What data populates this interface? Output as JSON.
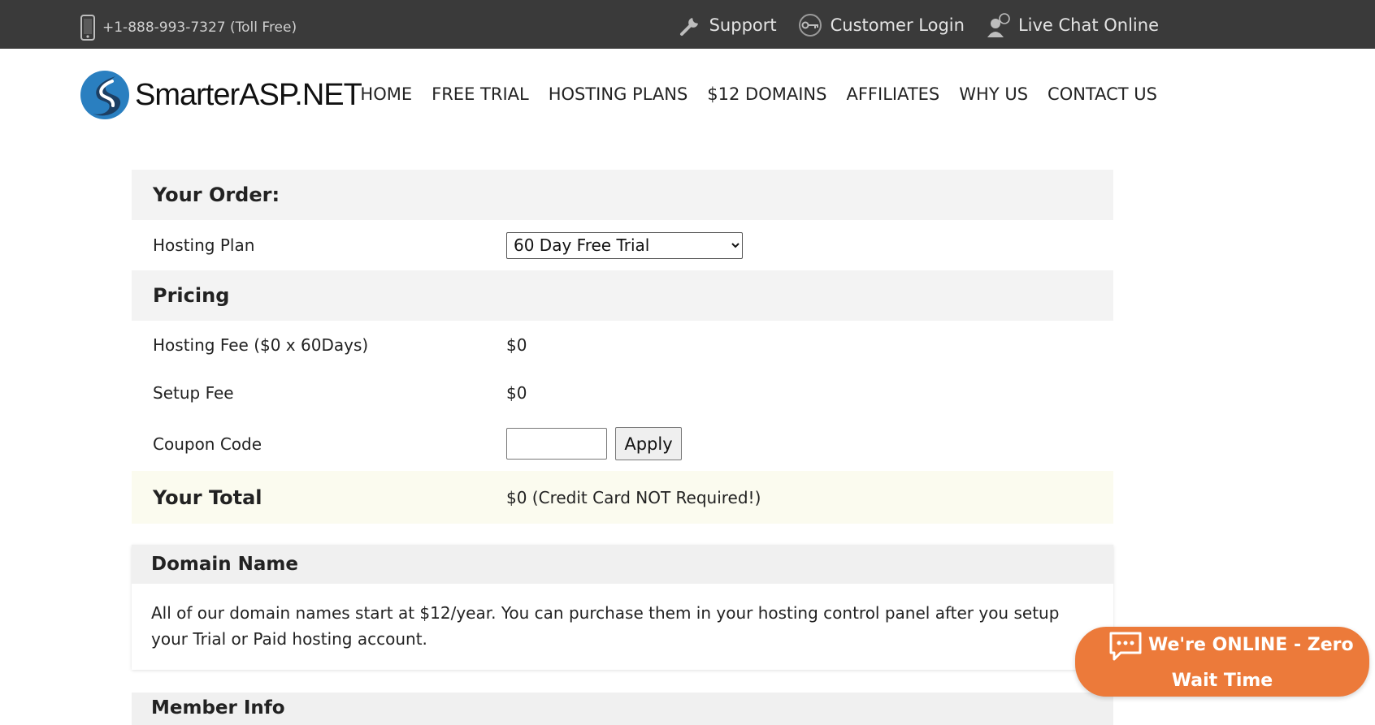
{
  "topbar": {
    "phone": "+1-888-993-7327 (Toll Free)",
    "links": [
      "Support",
      "Customer Login",
      "Live Chat Online"
    ]
  },
  "logo": {
    "text": "SmarterASP.NET"
  },
  "nav": [
    "HOME",
    "FREE TRIAL",
    "HOSTING PLANS",
    "$12 DOMAINS",
    "AFFILIATES",
    "WHY US",
    "CONTACT US"
  ],
  "order": {
    "heading": "Your Order:",
    "plan_label": "Hosting Plan",
    "plan_selected": "60 Day Free Trial",
    "pricing_heading": "Pricing",
    "hosting_fee_label": "Hosting Fee ($0 x 60Days)",
    "hosting_fee_value": "$0",
    "setup_fee_label": "Setup Fee",
    "setup_fee_value": "$0",
    "coupon_label": "Coupon Code",
    "coupon_value": "",
    "apply_label": "Apply",
    "total_label": "Your Total",
    "total_value": "$0 (Credit Card NOT Required!)"
  },
  "domain": {
    "heading": "Domain Name",
    "body": "All of our domain names start at $12/year. You can purchase them in your hosting control panel after you setup your Trial or Paid hosting account."
  },
  "member": {
    "heading": "Member Info"
  },
  "chat": {
    "line1": "We're ONLINE - Zero",
    "line2": "Wait Time"
  },
  "colors": {
    "topbar": "#3a3a3a",
    "chat": "#ec7a3a",
    "logo_blue": "#2a7fc0",
    "logo_dark": "#1d3f63"
  },
  "icons": [
    "phone-icon",
    "wrench-icon",
    "key-icon",
    "chat-person-icon",
    "chat-bubble-icon",
    "chevron-down-icon"
  ]
}
